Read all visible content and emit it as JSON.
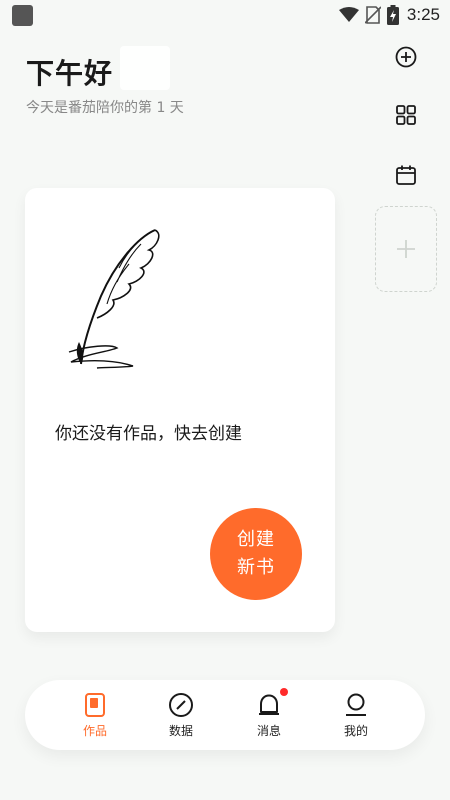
{
  "status_bar": {
    "time": "3:25",
    "icons": [
      "wifi-icon",
      "no-sim-icon",
      "battery-charging-icon"
    ]
  },
  "header": {
    "greeting": "下午好",
    "subtitle": "今天是番茄陪你的第 1 天"
  },
  "side_tools": [
    {
      "name": "add-circle-icon"
    },
    {
      "name": "grid-icon"
    },
    {
      "name": "calendar-icon"
    },
    {
      "name": "add-slot-icon"
    }
  ],
  "card": {
    "empty_text": "你还没有作品，快去创建",
    "create_button": {
      "line1": "创建",
      "line2": "新书"
    }
  },
  "colors": {
    "accent": "#ff6b2b",
    "badge": "#ff2a2a",
    "background": "#f6f8f6"
  },
  "bottom_nav": {
    "items": [
      {
        "label": "作品",
        "icon": "works-icon",
        "active": true
      },
      {
        "label": "数据",
        "icon": "data-compass-icon",
        "active": false
      },
      {
        "label": "消息",
        "icon": "bell-icon",
        "active": false,
        "badge": true
      },
      {
        "label": "我的",
        "icon": "profile-icon",
        "active": false
      }
    ]
  }
}
